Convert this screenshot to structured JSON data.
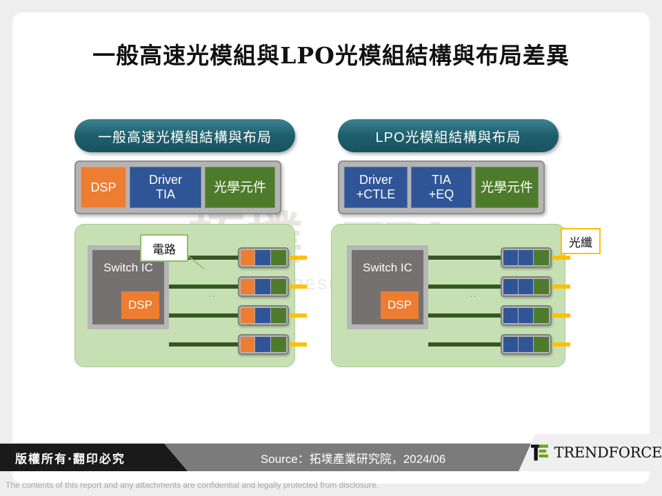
{
  "title": "一般高速光模組與LPO光模組結構與布局差異",
  "watermark": {
    "chinese": "拓墣",
    "acronym": "TRI",
    "subtitle": "TOPOLOGY RESEARCH INSTITUTE"
  },
  "left_panel": {
    "header": "一般高速光模組結構與布局",
    "module_strip": [
      {
        "label": "DSP",
        "color": "#ed7d31"
      },
      {
        "label": "Driver\nTIA",
        "line1": "Driver",
        "line2": "TIA",
        "color": "#2f5597"
      },
      {
        "label": "光學元件",
        "color": "#4e7b2b"
      }
    ],
    "board": {
      "switch_label": "Switch IC",
      "dsp_label": "DSP",
      "ellipsis": "..",
      "optical_modules": 4,
      "segments": [
        "orange",
        "blue",
        "green"
      ]
    }
  },
  "right_panel": {
    "header": "LPO光模組結構與布局",
    "module_strip": [
      {
        "label": "Driver\n+CTLE",
        "line1": "Driver",
        "line2": "+CTLE",
        "color": "#2f5597"
      },
      {
        "label": "TIA\n+EQ",
        "line1": "TIA",
        "line2": "+EQ",
        "color": "#2f5597"
      },
      {
        "label": "光學元件",
        "color": "#4e7b2b"
      }
    ],
    "board": {
      "switch_label": "Switch IC",
      "dsp_label": "DSP",
      "ellipsis": "..",
      "optical_modules": 4,
      "segments": [
        "blue",
        "blue",
        "green"
      ]
    }
  },
  "callouts": {
    "circuit": "電路",
    "fiber": "光纖"
  },
  "footer": {
    "copyright": "版權所有‧翻印必究",
    "source": "Source：拓墣產業研究院，2024/06",
    "brand": "TRENDFORCE",
    "disclaimer": "The contents of this report and any attachments are confidential and legally protected from disclosure."
  },
  "colors": {
    "header_teal": "#1f5f6d",
    "orange": "#ed7d31",
    "blue": "#2f5597",
    "green": "#4e7b2b",
    "board_green": "#c6e0b4",
    "trace_green": "#375623",
    "fiber_yellow": "#ffc000",
    "switch_grey": "#767171"
  }
}
